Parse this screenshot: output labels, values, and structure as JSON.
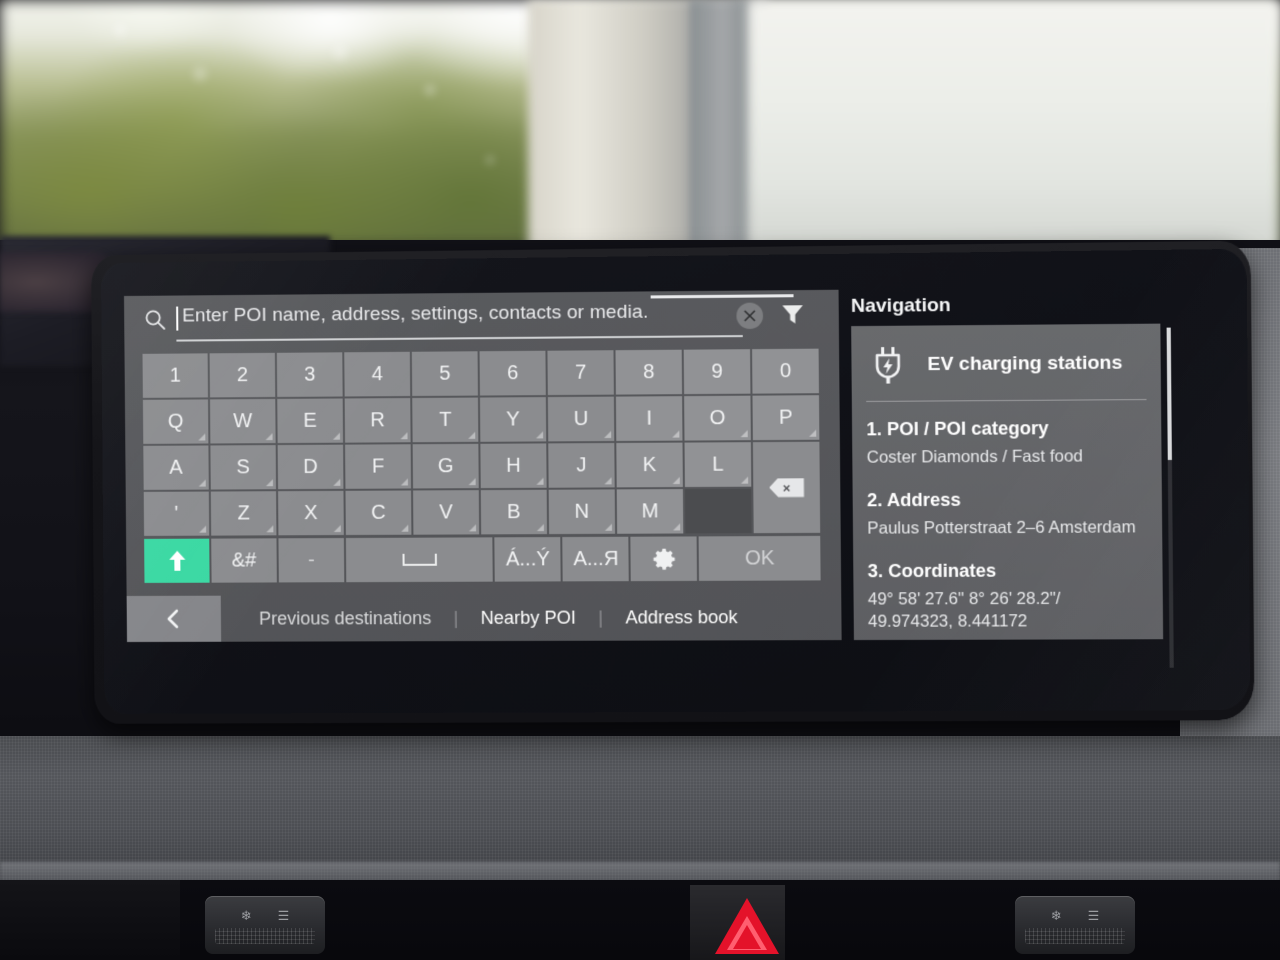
{
  "search": {
    "placeholder": "Enter POI name, address, settings, contacts or media.",
    "value": "",
    "search_icon": "search-icon",
    "clear_icon": "clear-circle-x-icon",
    "filter_icon": "filter-funnel-icon"
  },
  "keyboard": {
    "rows": [
      [
        "1",
        "2",
        "3",
        "4",
        "5",
        "6",
        "7",
        "8",
        "9",
        "0"
      ],
      [
        "Q",
        "W",
        "E",
        "R",
        "T",
        "Y",
        "U",
        "I",
        "O",
        "P"
      ],
      [
        "A",
        "S",
        "D",
        "F",
        "G",
        "H",
        "J",
        "K",
        "L"
      ],
      [
        "'",
        "Z",
        "X",
        "C",
        "V",
        "B",
        "N",
        "M"
      ]
    ],
    "backspace_label": "×",
    "function_row": {
      "shift_label": "↑",
      "symbols_label": "&#",
      "hyphen_label": "-",
      "space_label": "",
      "accents_label": "Á...Ý",
      "cyrillic_label": "А...Я",
      "settings_label": "gear-icon",
      "ok_label": "OK"
    }
  },
  "bottom_bar": {
    "back_label": "<",
    "links": [
      "Previous destinations",
      "Nearby POI",
      "Address book"
    ],
    "separator": "|"
  },
  "navigation": {
    "title": "Navigation",
    "featured": {
      "icon": "ev-charging-plug-icon",
      "label": "EV charging stations"
    },
    "sections": [
      {
        "heading": "1. POI / POI category",
        "value": "Coster Diamonds / Fast food"
      },
      {
        "heading": "2. Address",
        "value": "Paulus Potterstraat 2–6 Amsterdam"
      },
      {
        "heading": "3. Coordinates",
        "value": "49° 58' 27.6\" 8° 26' 28.2\"/\n49.974323, 8.441172"
      }
    ]
  },
  "colors": {
    "accent_green": "#3ad9a3",
    "key_gray": "#8b8c8f",
    "panel_gray": "#5c5d60",
    "card_gray": "#747578",
    "text_white": "#ffffff",
    "hazard_red": "#e4122a"
  }
}
